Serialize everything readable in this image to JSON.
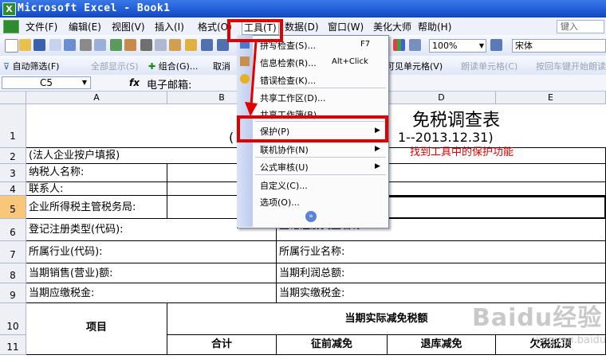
{
  "window": {
    "title": "Microsoft Excel - Book1"
  },
  "menubar": {
    "items": [
      "文件(F)",
      "编辑(E)",
      "视图(V)",
      "插入(I)",
      "格式(O)",
      "工具(T)",
      "数据(D)",
      "窗口(W)",
      "美化大师",
      "帮助(H)"
    ],
    "help_box": "键入"
  },
  "toolbar": {
    "zoom": "100%",
    "font": "宋体"
  },
  "toolbar2": {
    "autofilter": "自动筛选(F)",
    "show_all": "全部显示(S)",
    "group": "组合(G)...",
    "cancel": "取消",
    "visible_cells": "可见单元格(V)",
    "read_cell": "朗读单元格(C)",
    "read_enter": "按回车键开始朗读"
  },
  "formula_bar": {
    "name_box": "C5",
    "fx": "fx",
    "content": "电子邮箱:"
  },
  "columns": [
    "A",
    "B",
    "C",
    "D",
    "E"
  ],
  "rows": [
    "1",
    "2",
    "3",
    "4",
    "5",
    "6",
    "7",
    "8",
    "9",
    "10",
    "11"
  ],
  "sheet": {
    "title_fragment": "免税调查表",
    "paren_left": "(",
    "date_fragment": "1--2013.12.31)",
    "r2": "(法人企业按户填报)",
    "r3": "纳税人名称:",
    "r4": "联系人:",
    "r5": "企业所得税主管税务局:",
    "r6a": "登记注册类型(代码):",
    "r6b": "登记注册类型名称:",
    "r7a": "所属行业(代码):",
    "r7b": "所属行业名称:",
    "r8a": "当期销售(营业)额:",
    "r8b": "当期利润总额:",
    "r9a": "当期应缴税金:",
    "r9b": "当期实缴税金:",
    "r10_item": "项目",
    "r10_header": "当期实际减免税额",
    "r11": [
      "合计",
      "征前减免",
      "退库减免",
      "欠税抵顶"
    ]
  },
  "tools_menu": {
    "items": [
      {
        "label": "拼写检查(S)...",
        "shortcut": "F7"
      },
      {
        "label": "信息检索(R)...",
        "shortcut": "Alt+Click"
      },
      {
        "label": "错误检查(K)...",
        "shortcut": ""
      },
      {
        "label": "共享工作区(D)...",
        "shortcut": ""
      },
      {
        "label": "共享工作簿(B)...",
        "shortcut": ""
      },
      {
        "label": "保护(P)",
        "shortcut": ""
      },
      {
        "label": "联机协作(N)",
        "shortcut": ""
      },
      {
        "label": "公式审核(U)",
        "shortcut": ""
      },
      {
        "label": "自定义(C)...",
        "shortcut": ""
      },
      {
        "label": "选项(O)...",
        "shortcut": ""
      }
    ]
  },
  "annotation": {
    "text": "找到工具中的保护功能",
    "color": "#e00000"
  },
  "watermark": {
    "text": "Baidu经验",
    "sub": "jingyan.baidu.com"
  }
}
